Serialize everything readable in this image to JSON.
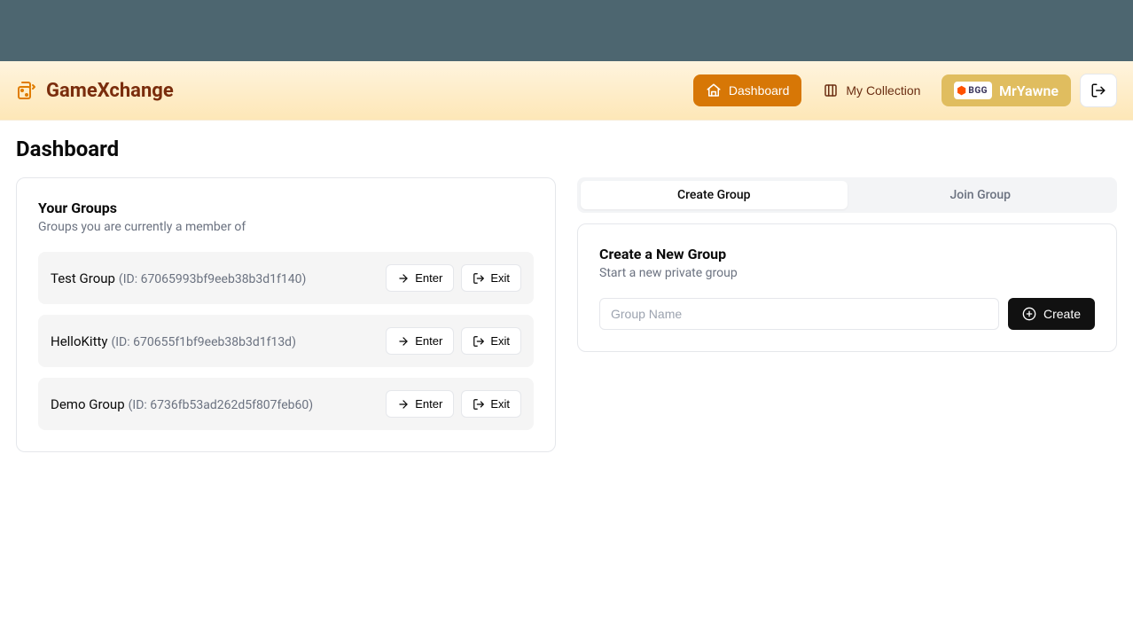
{
  "brand": "GameXchange",
  "nav": {
    "dashboard": "Dashboard",
    "collection": "My Collection",
    "username": "MrYawne",
    "bgg_label": "BGG"
  },
  "page_title": "Dashboard",
  "your_groups": {
    "title": "Your Groups",
    "subtitle": "Groups you are currently a member of",
    "enter_label": "Enter",
    "exit_label": "Exit",
    "items": [
      {
        "name": "Test Group",
        "id": "67065993bf9eeb38b3d1f140"
      },
      {
        "name": "HelloKitty",
        "id": "670655f1bf9eeb38b3d1f13d"
      },
      {
        "name": "Demo Group",
        "id": "6736fb53ad262d5f807feb60"
      }
    ]
  },
  "tabs": {
    "create": "Create Group",
    "join": "Join Group"
  },
  "create_group": {
    "title": "Create a New Group",
    "subtitle": "Start a new private group",
    "placeholder": "Group Name",
    "button": "Create"
  }
}
